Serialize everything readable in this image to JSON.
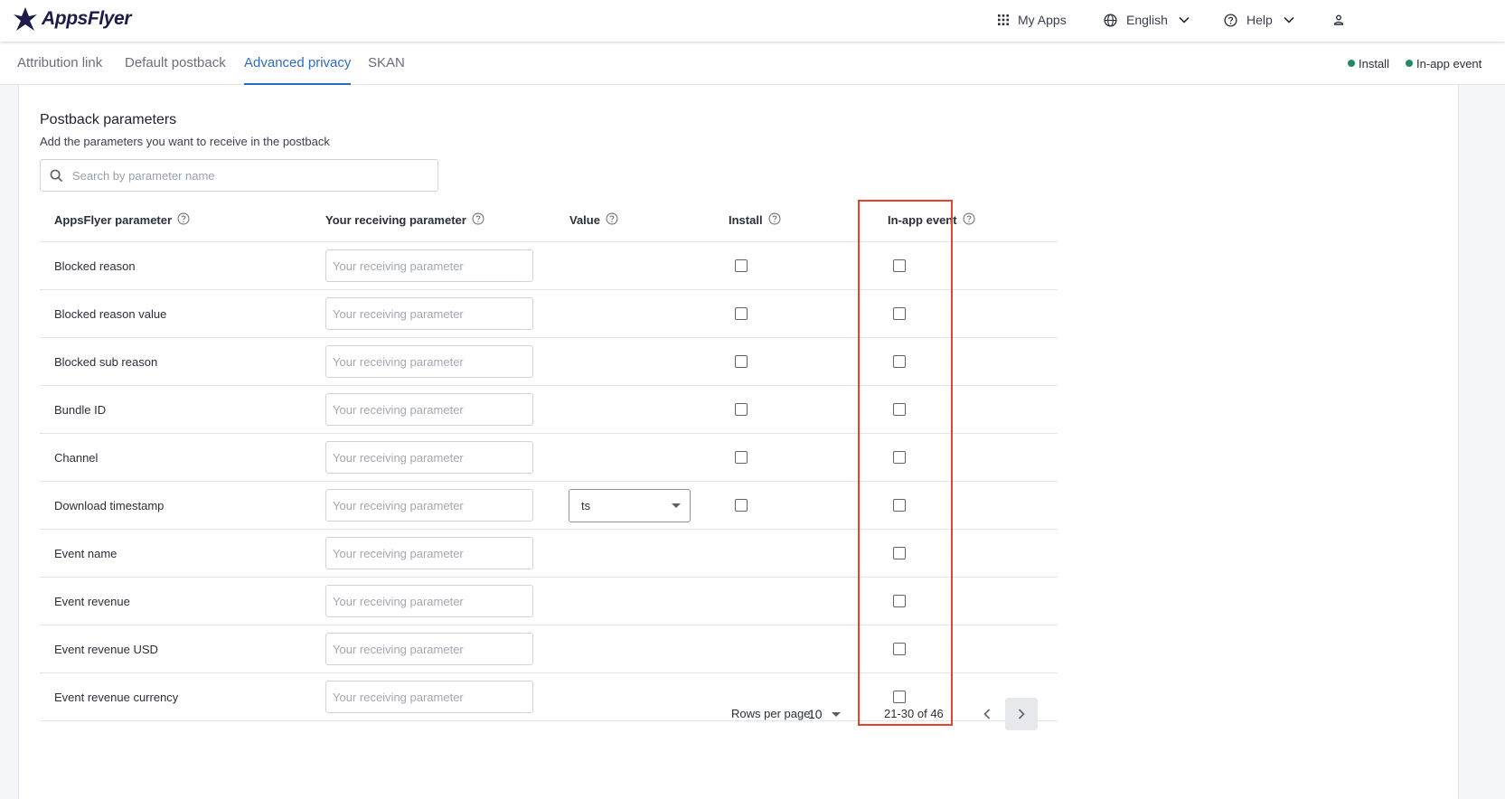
{
  "header": {
    "brand": "AppsFlyer",
    "my_apps": "My Apps",
    "language": "English",
    "help": "Help"
  },
  "tabs": [
    {
      "label": "Attribution link"
    },
    {
      "label": "Default postback"
    },
    {
      "label": "Advanced privacy"
    },
    {
      "label": "SKAN"
    }
  ],
  "legend": {
    "install": "Install",
    "in_app_event": "In-app event"
  },
  "section": {
    "title": "Postback parameters",
    "subtitle": "Add the parameters you want to receive in the postback"
  },
  "search": {
    "placeholder": "Search by parameter name"
  },
  "columns": {
    "appsflyer_parameter": "AppsFlyer parameter",
    "receiving_parameter": "Your receiving parameter",
    "value": "Value",
    "install": "Install",
    "in_app_event": "In-app event"
  },
  "receiving_placeholder": "Your receiving parameter",
  "rows": [
    {
      "name": "Blocked reason",
      "has_install": true
    },
    {
      "name": "Blocked reason value",
      "has_install": true
    },
    {
      "name": "Blocked sub reason",
      "has_install": true
    },
    {
      "name": "Bundle ID",
      "has_install": true
    },
    {
      "name": "Channel",
      "has_install": true
    },
    {
      "name": "Download timestamp",
      "has_install": true,
      "value": "ts"
    },
    {
      "name": "Event name",
      "has_install": false
    },
    {
      "name": "Event revenue",
      "has_install": false
    },
    {
      "name": "Event revenue USD",
      "has_install": false
    },
    {
      "name": "Event revenue currency",
      "has_install": false
    }
  ],
  "pagination": {
    "rows_per_page_label": "Rows per page:",
    "rows_per_page": "10",
    "range": "21-30 of 46"
  },
  "colors": {
    "accent": "#2f6bc5",
    "legend_dot": "#1f8b68",
    "highlight": "#e8412c"
  }
}
